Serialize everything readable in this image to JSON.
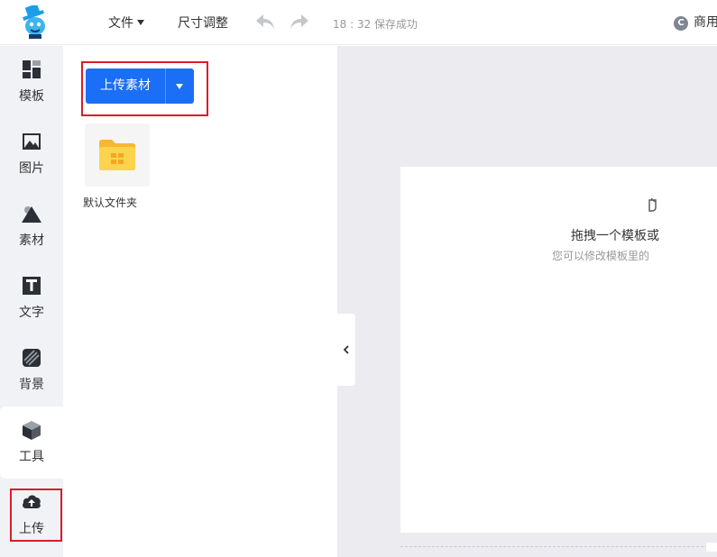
{
  "header": {
    "menu_file": "文件",
    "menu_resize": "尺寸调整",
    "save_status": "18 : 32 保存成功",
    "commercial_icon": "C",
    "commercial_label": "商用"
  },
  "sidebar": {
    "items": [
      {
        "label": "模板",
        "icon": "template-icon"
      },
      {
        "label": "图片",
        "icon": "image-icon"
      },
      {
        "label": "素材",
        "icon": "shapes-icon"
      },
      {
        "label": "文字",
        "icon": "text-icon"
      },
      {
        "label": "背景",
        "icon": "background-icon"
      },
      {
        "label": "工具",
        "icon": "tools-icon"
      },
      {
        "label": "上传",
        "icon": "cloud-upload-icon",
        "active": true
      }
    ]
  },
  "panel": {
    "upload_button": "上传素材",
    "folders": [
      {
        "name": "默认文件夹",
        "icon": "folder-icon"
      }
    ]
  },
  "canvas": {
    "drop_title": "拖拽一个模板或",
    "drop_subtitle": "您可以修改模板里的"
  },
  "colors": {
    "accent": "#1a6ff6",
    "highlight_box": "#d81e2a",
    "sidebar_bg": "#f1f2f5",
    "canvas_bg": "#ebebf0"
  }
}
